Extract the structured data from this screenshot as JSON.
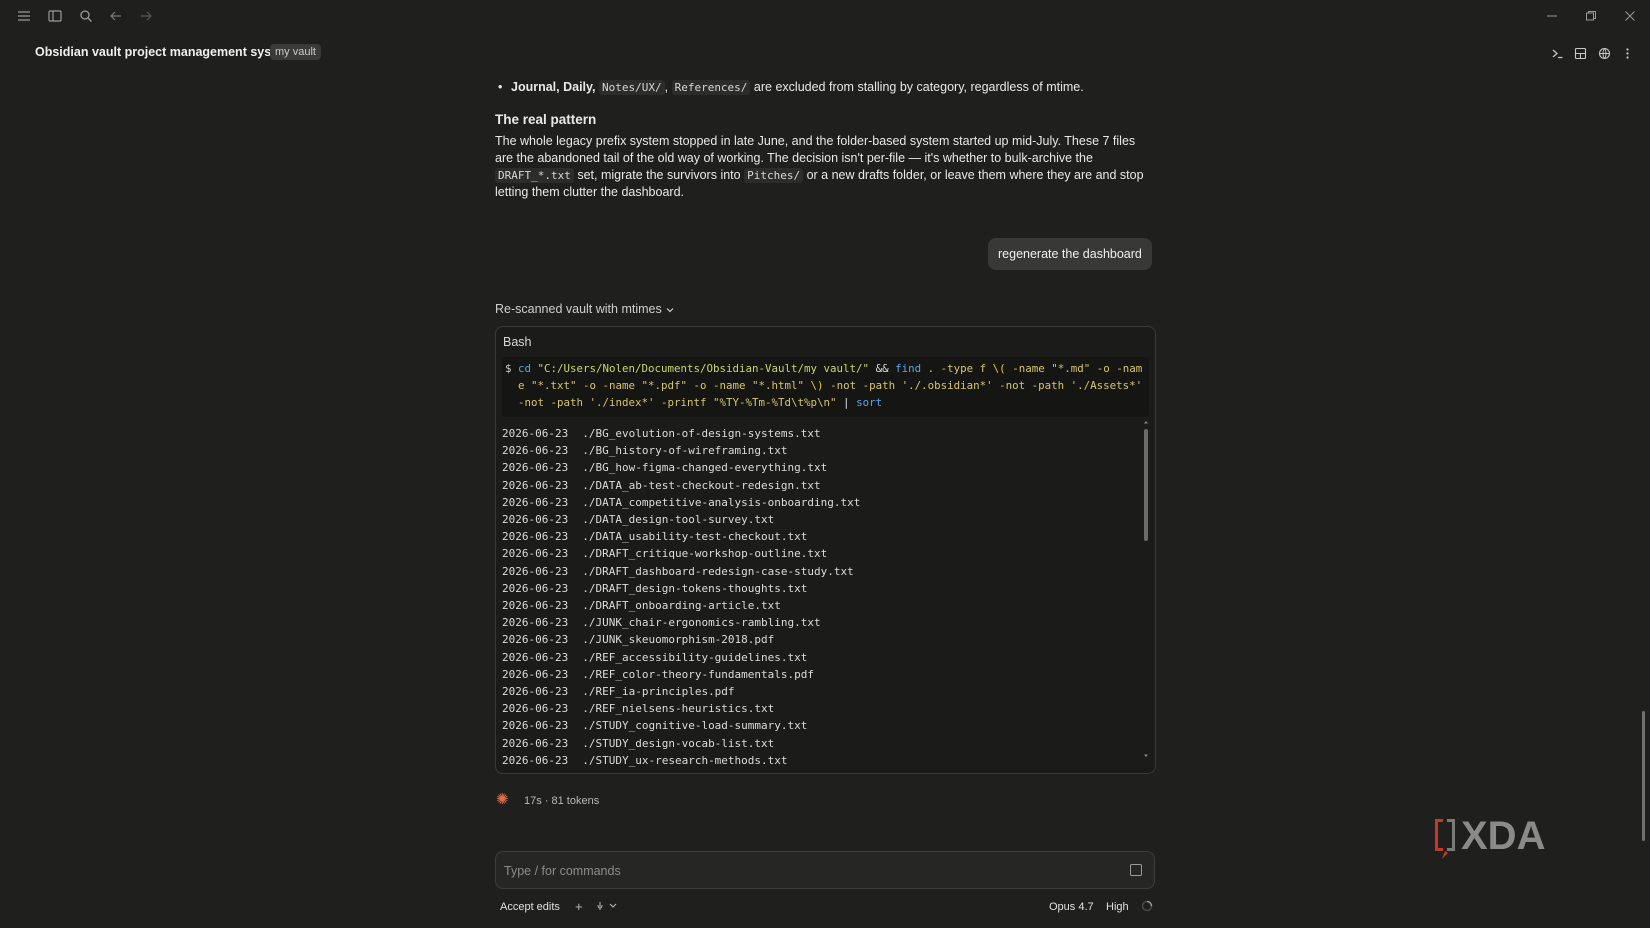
{
  "header": {
    "title": "Obsidian vault project management system",
    "vault_badge": "my vault"
  },
  "message": {
    "bullet_bold": "Journal, Daily,",
    "bullet_code1": "Notes/UX/",
    "bullet_sep": ",",
    "bullet_code2": "References/",
    "bullet_rest": "are excluded from stalling by category, regardless of mtime.",
    "heading": "The real pattern",
    "para_1": "The whole legacy prefix system stopped in late June, and the folder-based system started up mid-July. These 7 files are the abandoned tail of the old way of working. The decision isn't per-file — it's whether to bulk-archive the",
    "para_code1": "DRAFT_*.txt",
    "para_2": "set, migrate the survivors into",
    "para_code2": "Pitches/",
    "para_3": "or a new drafts folder, or leave them where they are and stop letting them clutter the dashboard."
  },
  "user_message": "regenerate the dashboard",
  "tool": {
    "summary": "Re-scanned vault with mtimes",
    "label": "Bash",
    "prompt": "$",
    "cmd": {
      "cd": "cd",
      "path": "\"C:/Users/Nolen/Documents/Obsidian-Vault/my vault/\"",
      "and": "&&",
      "find": "find",
      "args1": ". -type f",
      "lparen": "\\(",
      "args2": "-name \"*.md\" -o -name \"*.txt\" -o -name \"*.pdf\" -o -name \"*.html\"",
      "rparen": "\\)",
      "args3": "-not -path './.obsidian*' -not -path './Assets*' -not -path './index*' -printf \"%TY-%Tm-%Td\\t%p\\n\"",
      "pipe": "|",
      "sort": "sort"
    },
    "output": [
      {
        "date": "2026-06-23",
        "path": "./BG_evolution-of-design-systems.txt"
      },
      {
        "date": "2026-06-23",
        "path": "./BG_history-of-wireframing.txt"
      },
      {
        "date": "2026-06-23",
        "path": "./BG_how-figma-changed-everything.txt"
      },
      {
        "date": "2026-06-23",
        "path": "./DATA_ab-test-checkout-redesign.txt"
      },
      {
        "date": "2026-06-23",
        "path": "./DATA_competitive-analysis-onboarding.txt"
      },
      {
        "date": "2026-06-23",
        "path": "./DATA_design-tool-survey.txt"
      },
      {
        "date": "2026-06-23",
        "path": "./DATA_usability-test-checkout.txt"
      },
      {
        "date": "2026-06-23",
        "path": "./DRAFT_critique-workshop-outline.txt"
      },
      {
        "date": "2026-06-23",
        "path": "./DRAFT_dashboard-redesign-case-study.txt"
      },
      {
        "date": "2026-06-23",
        "path": "./DRAFT_design-tokens-thoughts.txt"
      },
      {
        "date": "2026-06-23",
        "path": "./DRAFT_onboarding-article.txt"
      },
      {
        "date": "2026-06-23",
        "path": "./JUNK_chair-ergonomics-rambling.txt"
      },
      {
        "date": "2026-06-23",
        "path": "./JUNK_skeuomorphism-2018.pdf"
      },
      {
        "date": "2026-06-23",
        "path": "./REF_accessibility-guidelines.txt"
      },
      {
        "date": "2026-06-23",
        "path": "./REF_color-theory-fundamentals.pdf"
      },
      {
        "date": "2026-06-23",
        "path": "./REF_ia-principles.pdf"
      },
      {
        "date": "2026-06-23",
        "path": "./REF_nielsens-heuristics.txt"
      },
      {
        "date": "2026-06-23",
        "path": "./STUDY_cognitive-load-summary.txt"
      },
      {
        "date": "2026-06-23",
        "path": "./STUDY_design-vocab-list.txt"
      },
      {
        "date": "2026-06-23",
        "path": "./STUDY_ux-research-methods.txt"
      }
    ]
  },
  "stats": "17s · 81 tokens",
  "input": {
    "placeholder": "Type / for commands",
    "value": ""
  },
  "bottom": {
    "accept_edits": "Accept edits",
    "add": "+",
    "model": "Opus 4.7",
    "effort": "High"
  },
  "watermark": "XDA",
  "colors": {
    "background": "#1f1f1e",
    "accent": "#d9704a",
    "string": "#c8d86a",
    "keyword": "#5aa3e8"
  }
}
